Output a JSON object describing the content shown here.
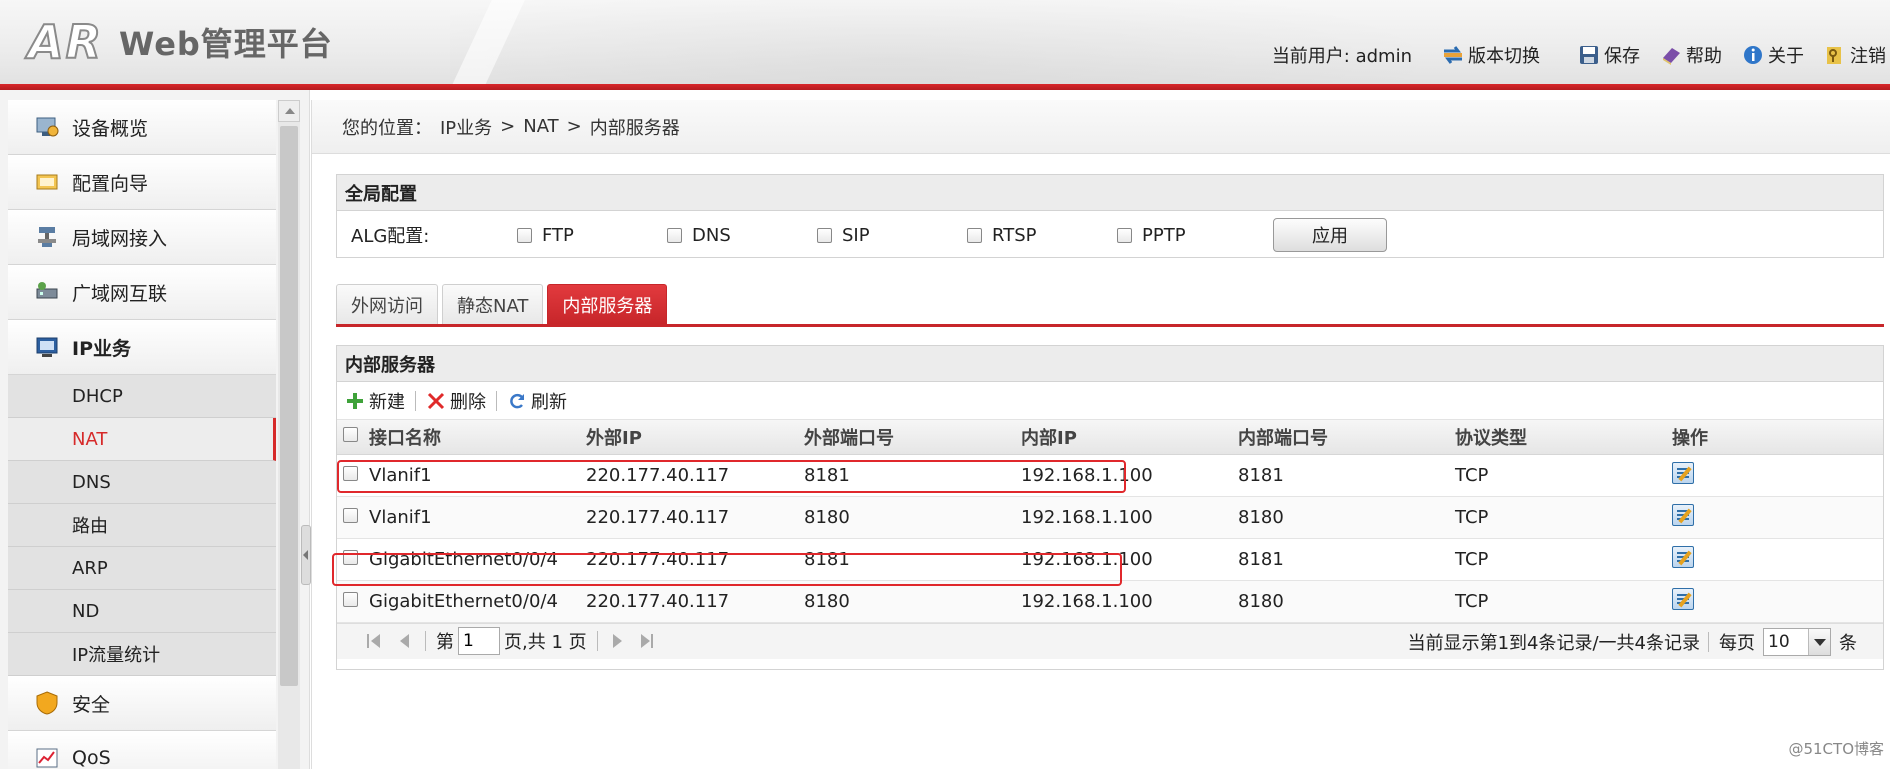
{
  "header": {
    "logo_text": "AR",
    "app_title": "Web管理平台",
    "current_user": "当前用户: admin",
    "actions": [
      {
        "label": "版本切换",
        "icon": "switch-version-icon"
      },
      {
        "label": "保存",
        "icon": "save-icon"
      },
      {
        "label": "帮助",
        "icon": "help-book-icon"
      },
      {
        "label": "关于",
        "icon": "info-icon"
      },
      {
        "label": "注销",
        "icon": "logout-key-icon"
      }
    ]
  },
  "sidebar": {
    "items": [
      {
        "label": "设备概览",
        "icon": "device-overview-icon"
      },
      {
        "label": "配置向导",
        "icon": "config-wizard-icon"
      },
      {
        "label": "局域网接入",
        "icon": "lan-access-icon"
      },
      {
        "label": "广域网互联",
        "icon": "wan-interconnect-icon"
      },
      {
        "label": "IP业务",
        "icon": "ip-service-icon"
      }
    ],
    "subitems": [
      "DHCP",
      "NAT",
      "DNS",
      "路由",
      "ARP",
      "ND",
      "IP流量统计"
    ],
    "selected_subitem": "NAT",
    "items_after": [
      {
        "label": "安全",
        "icon": "shield-icon"
      },
      {
        "label": "QoS",
        "icon": "qos-icon"
      }
    ]
  },
  "breadcrumb": {
    "prefix": "您的位置：",
    "path": [
      "IP业务",
      ">",
      "NAT",
      ">",
      "内部服务器"
    ]
  },
  "global_config": {
    "title": "全局配置",
    "alg_label": "ALG配置:",
    "options": [
      "FTP",
      "DNS",
      "SIP",
      "RTSP",
      "PPTP"
    ],
    "apply_label": "应用"
  },
  "tabs": [
    {
      "label": "外网访问",
      "active": false
    },
    {
      "label": "静态NAT",
      "active": false
    },
    {
      "label": "内部服务器",
      "active": true
    }
  ],
  "server_table": {
    "title": "内部服务器",
    "toolbar": {
      "new": "新建",
      "delete": "删除",
      "refresh": "刷新"
    },
    "columns": [
      "接口名称",
      "外部IP",
      "外部端口号",
      "内部IP",
      "内部端口号",
      "协议类型",
      "操作"
    ],
    "rows": [
      [
        "Vlanif1",
        "220.177.40.117",
        "8181",
        "192.168.1.100",
        "8181",
        "TCP"
      ],
      [
        "Vlanif1",
        "220.177.40.117",
        "8180",
        "192.168.1.100",
        "8180",
        "TCP"
      ],
      [
        "GigabitEthernet0/0/4",
        "220.177.40.117",
        "8181",
        "192.168.1.100",
        "8181",
        "TCP"
      ],
      [
        "GigabitEthernet0/0/4",
        "220.177.40.117",
        "8180",
        "192.168.1.100",
        "8180",
        "TCP"
      ]
    ]
  },
  "pager": {
    "page_prefix": "第",
    "page_value": "1",
    "page_suffix": "页,共 1 页",
    "summary": "当前显示第1到4条记录/一共4条记录",
    "per_page_label": "每页",
    "per_page_value": "10",
    "per_page_unit": "条"
  },
  "watermark": "@51CTO博客",
  "colors": {
    "accent": "#d62a2a",
    "header_bg": "#ececec"
  }
}
